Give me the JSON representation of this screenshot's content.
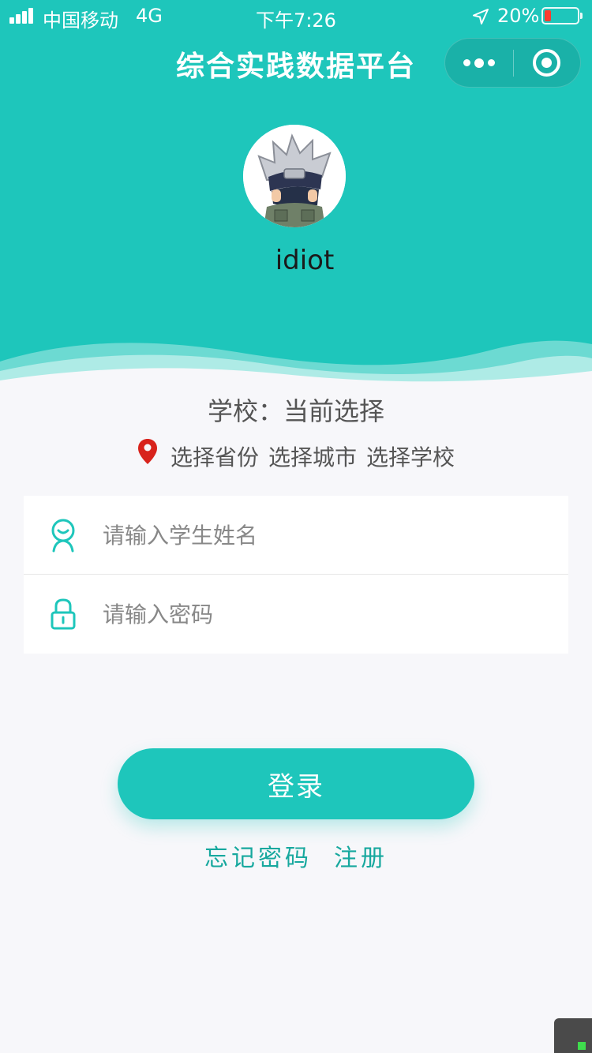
{
  "status_bar": {
    "carrier": "中国移动",
    "network": "4G",
    "time": "下午7:26",
    "battery_percent": "20%",
    "battery_level": 0.2,
    "battery_color": "#ff3b30",
    "icons": [
      "signal-icon",
      "location-arrow-icon",
      "battery-icon"
    ]
  },
  "nav": {
    "title": "综合实践数据平台",
    "icons": [
      "more-dots-icon",
      "close-target-icon"
    ]
  },
  "theme": {
    "primary": "#1ec6bb",
    "link": "#17a89e",
    "background": "#f7f7fa",
    "pin": "#d8231c"
  },
  "user": {
    "name": "idiot",
    "avatar_icon": "avatar-image"
  },
  "school": {
    "line": "学校：当前选择",
    "region": [
      "选择省份",
      "选择城市",
      "选择学校"
    ],
    "icon": "location-pin-icon"
  },
  "form": {
    "name_placeholder": "请输入学生姓名",
    "name_value": "",
    "name_icon": "user-face-icon",
    "password_placeholder": "请输入密码",
    "password_value": "",
    "password_icon": "lock-icon"
  },
  "actions": {
    "login": "登录",
    "forgot": "忘记密码",
    "register": "注册"
  }
}
